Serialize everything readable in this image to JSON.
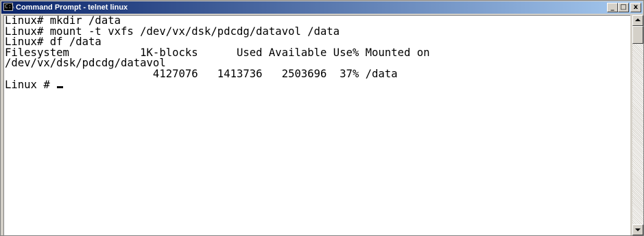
{
  "window": {
    "title": "Command Prompt - telnet linux",
    "icon": "console-icon",
    "icon_glyph": "C:\\",
    "buttons": {
      "minimize": "_",
      "maximize": "□",
      "close": "x"
    }
  },
  "console": {
    "lines": [
      "Linux# mkdir /data",
      "Linux# mount -t vxfs /dev/vx/dsk/pdcdg/datavol /data",
      "Linux# df /data",
      "Filesystem           1K-blocks      Used Available Use% Mounted on",
      "/dev/vx/dsk/pdcdg/datavol",
      "                       4127076   1413736   2503696  37% /data"
    ],
    "prompt": "Linux # "
  },
  "colors": {
    "title_start": "#0a246a",
    "title_end": "#a6caf0",
    "console_bg": "#ffffff",
    "console_fg": "#000000"
  }
}
